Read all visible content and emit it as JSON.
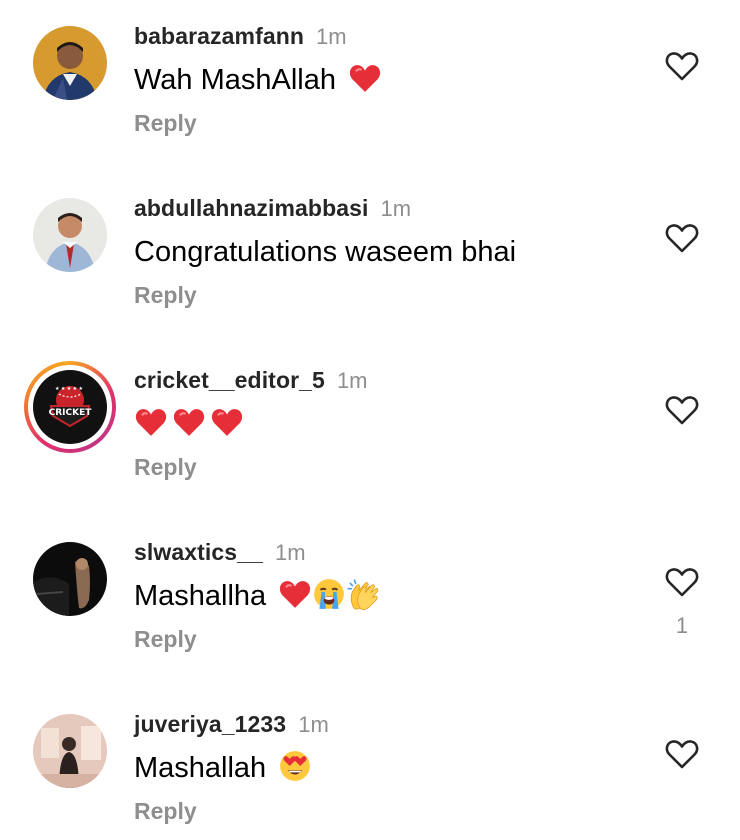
{
  "comments": [
    {
      "username": "babarazamfann",
      "time": "1m",
      "text": "Wah MashAllah",
      "emojis": [
        "red-heart-emoji"
      ],
      "reply_label": "Reply",
      "like_count": ""
    },
    {
      "username": "abdullahnazimabbasi",
      "time": "1m",
      "text": "Congratulations waseem bhai",
      "emojis": [],
      "reply_label": "Reply",
      "like_count": ""
    },
    {
      "username": "cricket__editor_5",
      "time": "1m",
      "text": "",
      "emojis": [
        "red-heart-emoji",
        "red-heart-emoji",
        "red-heart-emoji"
      ],
      "reply_label": "Reply",
      "like_count": "",
      "avatar_text": "CRICKET"
    },
    {
      "username": "slwaxtics__",
      "time": "1m",
      "text": "Mashallha",
      "emojis": [
        "red-heart-emoji",
        "crying-face-emoji",
        "clapping-hands-emoji"
      ],
      "reply_label": "Reply",
      "like_count": "1"
    },
    {
      "username": "juveriya_1233",
      "time": "1m",
      "text": "Mashallah",
      "emojis": [
        "heart-eyes-emoji"
      ],
      "reply_label": "Reply",
      "like_count": ""
    }
  ],
  "colors": {
    "username": "#262626",
    "secondary_text": "#8e8e8e",
    "heart_red": "#e62e38",
    "story_ring": [
      "#f5a623",
      "#e1306c",
      "#c13584"
    ]
  },
  "icons": {
    "like": "heart-outline-icon"
  }
}
